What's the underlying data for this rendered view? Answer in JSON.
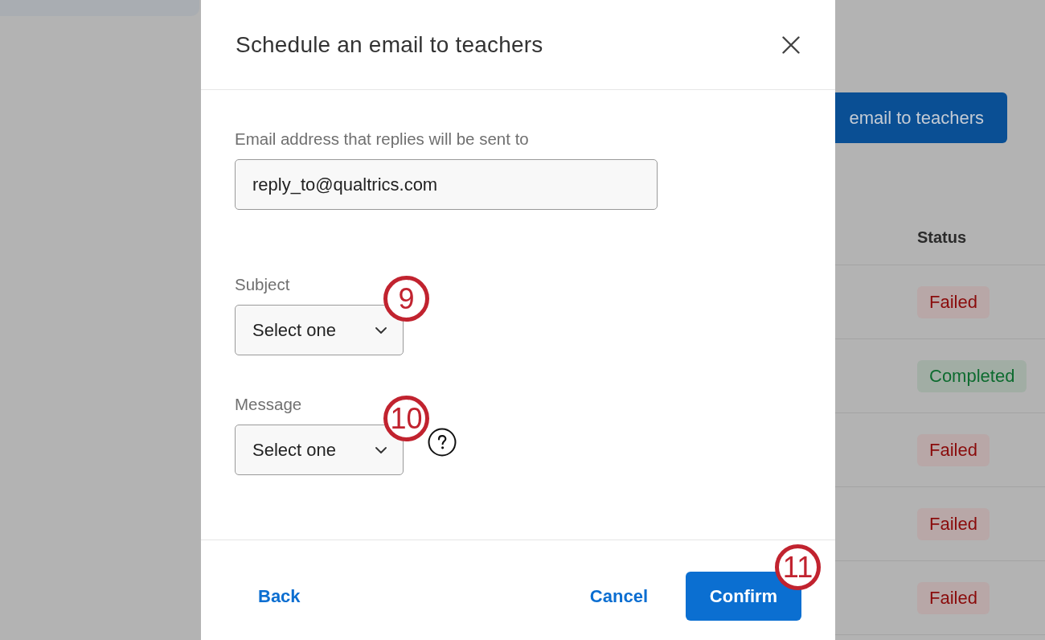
{
  "page": {
    "action_button": {
      "label": "email to teachers"
    },
    "table": {
      "columns": [
        "Status"
      ],
      "rows": [
        {
          "status": "Failed",
          "kind": "failed"
        },
        {
          "status": "Completed",
          "kind": "completed"
        },
        {
          "status": "Failed",
          "kind": "failed"
        },
        {
          "status": "Failed",
          "kind": "failed"
        },
        {
          "status": "Failed",
          "kind": "failed"
        }
      ]
    }
  },
  "dialog": {
    "title": "Schedule an email to teachers",
    "fields": [
      {
        "kind": "text",
        "label": "Email address that replies will be sent to",
        "value": "reply_to@qualtrics.com",
        "help": false
      },
      {
        "kind": "select",
        "label": "Subject",
        "value": "Select one",
        "help": false,
        "callout": "9"
      },
      {
        "kind": "select",
        "label": "Message",
        "value": "Select one",
        "help": true,
        "callout": "10"
      }
    ],
    "back_button": {
      "label": "Back"
    },
    "buttons": [
      {
        "label": "Cancel",
        "kind": "link"
      },
      {
        "label": "Confirm",
        "kind": "primary",
        "callout": "11"
      }
    ]
  }
}
